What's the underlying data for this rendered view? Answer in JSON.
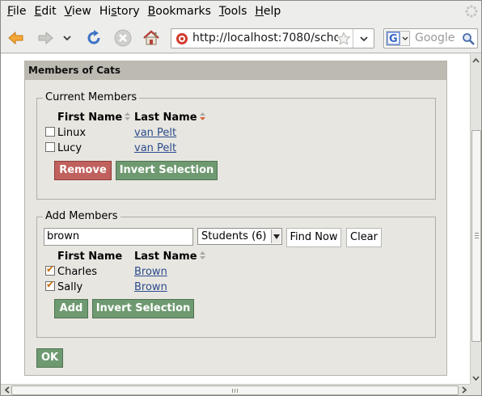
{
  "menubar": {
    "items": [
      {
        "label": "File",
        "accel": "F",
        "rest": "ile"
      },
      {
        "label": "Edit",
        "accel": "E",
        "rest": "dit"
      },
      {
        "label": "View",
        "accel": "V",
        "rest": "iew"
      },
      {
        "label": "History",
        "accel": "s",
        "pre": "Hi",
        "rest": "tory"
      },
      {
        "label": "Bookmarks",
        "accel": "B",
        "rest": "ookmarks"
      },
      {
        "label": "Tools",
        "accel": "T",
        "rest": "ools"
      },
      {
        "label": "Help",
        "accel": "H",
        "rest": "elp"
      }
    ]
  },
  "toolbar": {
    "url": "http://localhost:7080/schoo",
    "search_placeholder": "Google",
    "icons": [
      "back-arrow-icon",
      "forward-arrow-icon",
      "history-dropdown-icon",
      "reload-icon",
      "stop-icon",
      "home-icon",
      "site-favicon",
      "bookmark-star-icon",
      "url-dropdown-icon",
      "google-icon",
      "search-magnifier-icon"
    ]
  },
  "panel": {
    "title": "Members of Cats",
    "current": {
      "legend": "Current Members",
      "col_first": "First Name",
      "col_last": "Last Name",
      "rows": [
        {
          "first": "Linux",
          "last": "van Pelt",
          "checked": false
        },
        {
          "first": "Lucy",
          "last": "van Pelt",
          "checked": false
        }
      ],
      "remove_label": "Remove",
      "invert_label": "Invert Selection"
    },
    "add": {
      "legend": "Add Members",
      "search_value": "brown",
      "select_value": "Students (6)",
      "find_label": "Find Now",
      "clear_label": "Clear",
      "col_first": "First Name",
      "col_last": "Last Name",
      "rows": [
        {
          "first": "Charles",
          "last": "Brown",
          "checked": true
        },
        {
          "first": "Sally",
          "last": "Brown",
          "checked": true
        }
      ],
      "add_label": "Add",
      "invert_label": "Invert Selection"
    },
    "ok_label": "OK"
  },
  "colors": {
    "green_button": "#6f9a71",
    "red_button": "#c0615d",
    "panel_header": "#bdbab2",
    "link": "#2b4c8c"
  }
}
